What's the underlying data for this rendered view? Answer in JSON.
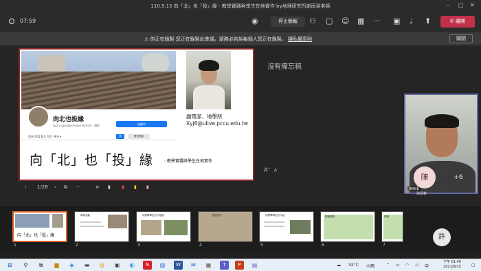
{
  "window": {
    "title": "110.9.15 向「北」也「投」緣 - 教學實踐與學生在地實作 by地理研究所謝雨潔老師"
  },
  "topbar": {
    "timer": "07:59",
    "share_label": "停止簡報",
    "leave_label": "離開"
  },
  "banner": {
    "text": "你正在錄製 您正在錄製此會議。請務必告訴每個人您正在錄製。",
    "link": "隱私權原則",
    "close": "關閉"
  },
  "slide": {
    "page_name": "向北也投緣",
    "page_handle": "@pccugeogbeitowexhibition · 攝影",
    "fb_button": "追蹤中",
    "fb_tabs": "首頁   評論   影片   相片   更多 ▾",
    "fb_like": "讚",
    "fb_message": "發送訊息",
    "author_name": "謝雨潔、地學所",
    "author_email": "Xyj6@ulive.pccu.edu.tw",
    "title": "向「北」也「投」緣",
    "subtitle": ": 教學實踐與學生在地實作"
  },
  "notes": {
    "empty_text": "沒有備忘稿"
  },
  "font_controls": {
    "increase": "A",
    "decrease": "A"
  },
  "slide_controls": {
    "page": "1/28"
  },
  "participants": {
    "self_label": "謝雨潔",
    "roster": [
      {
        "initial": "陳",
        "name": "陳穎蓁",
        "color": "#f3d8d8"
      },
      {
        "initial": "+6",
        "name": "",
        "color": "#3a3a3a"
      }
    ],
    "tile_initial": "許"
  },
  "thumbnails": [
    {
      "num": "1",
      "title": "向「北」也「投」緣"
    },
    {
      "num": "2",
      "title": "專案活動"
    },
    {
      "num": "3",
      "title": "地理學學生的介紹區"
    },
    {
      "num": "4",
      "title": "歷史照片"
    },
    {
      "num": "5",
      "title": "地理學學生的介紹"
    },
    {
      "num": "6",
      "title": "課程規劃"
    },
    {
      "num": "7",
      "title": "課程"
    }
  ],
  "taskbar": {
    "temp": "32°C",
    "weather": "小雨",
    "lang": "中",
    "time": "下午 01:40",
    "date": "2021/9/15"
  }
}
